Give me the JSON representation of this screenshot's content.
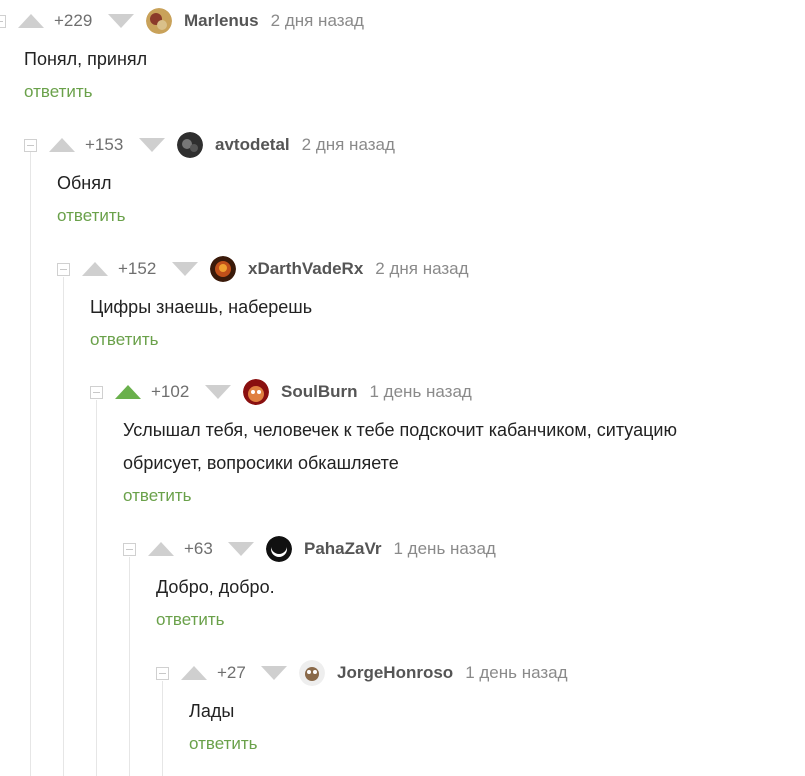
{
  "reply_label": "ответить",
  "colors": {
    "accent_green": "#6aa14a",
    "upvoted": "#6ab04c",
    "vote_gray": "#cfcfcf"
  },
  "comments": [
    {
      "rating": "+229",
      "author": "Marlenus",
      "time": "2 дня назад",
      "text": [
        "Понял, принял"
      ],
      "upvoted": false
    },
    {
      "rating": "+153",
      "author": "avtodetal",
      "time": "2 дня назад",
      "text": [
        "Обнял"
      ],
      "upvoted": false
    },
    {
      "rating": "+152",
      "author": "xDarthVadeRx",
      "time": "2 дня назад",
      "text": [
        "Цифры знаешь, наберешь"
      ],
      "upvoted": false
    },
    {
      "rating": "+102",
      "author": "SoulBurn",
      "time": "1 день назад",
      "text": [
        "Услышал тебя, человечек к тебе подскочит кабанчиком, ситуацию",
        "обрисует, вопросики обкашляете"
      ],
      "upvoted": true
    },
    {
      "rating": "+63",
      "author": "PahaZaVr",
      "time": "1 день назад",
      "text": [
        "Добро, добро."
      ],
      "upvoted": false
    },
    {
      "rating": "+27",
      "author": "JorgeHonroso",
      "time": "1 день назад",
      "text": [
        "Лады"
      ],
      "upvoted": false
    }
  ]
}
